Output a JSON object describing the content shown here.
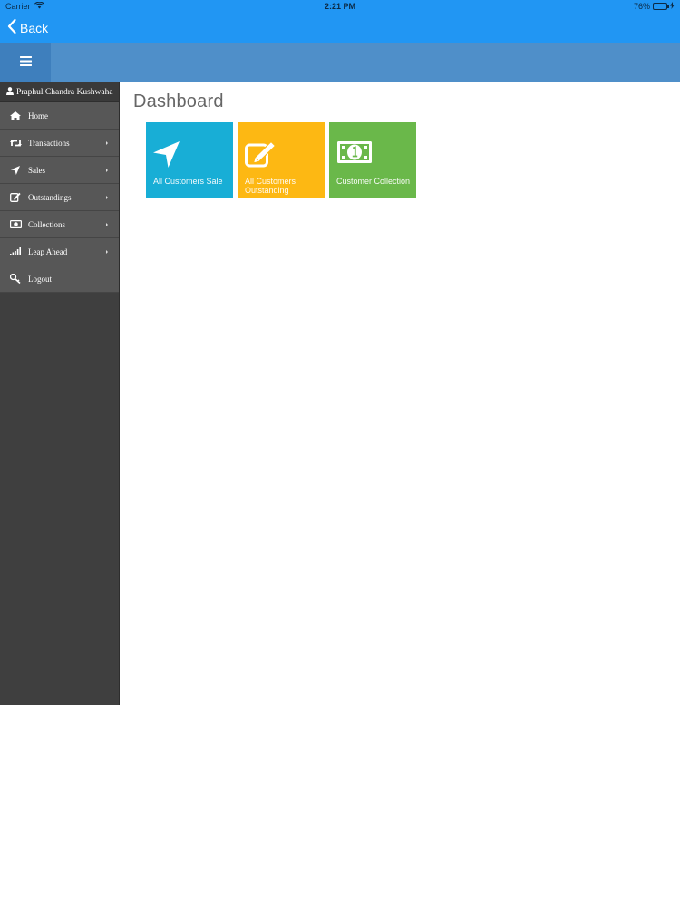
{
  "status_bar": {
    "carrier": "Carrier",
    "time": "2:21 PM",
    "battery": "76%",
    "battery_level": 0.76
  },
  "nav": {
    "back_label": "Back"
  },
  "sidebar": {
    "user_name": "Praphul Chandra Kushwaha",
    "items": [
      {
        "label": "Home",
        "icon": "home-icon",
        "has_submenu": false
      },
      {
        "label": "Transactions",
        "icon": "retweet-icon",
        "has_submenu": true
      },
      {
        "label": "Sales",
        "icon": "location-arrow-icon",
        "has_submenu": true
      },
      {
        "label": "Outstandings",
        "icon": "edit-icon",
        "has_submenu": true
      },
      {
        "label": "Collections",
        "icon": "money-icon",
        "has_submenu": true
      },
      {
        "label": "Leap Ahead",
        "icon": "signal-icon",
        "has_submenu": true
      },
      {
        "label": "Logout",
        "icon": "key-icon",
        "has_submenu": false
      }
    ]
  },
  "main": {
    "title": "Dashboard",
    "tiles": [
      {
        "label": "All Customers Sale",
        "icon": "location-arrow-icon",
        "color": "#18aed6"
      },
      {
        "label": "All Customers Outstanding",
        "icon": "edit-icon",
        "color": "#fdb813"
      },
      {
        "label": "Customer Collection",
        "icon": "money-icon",
        "color": "#6ab84a"
      }
    ]
  },
  "colors": {
    "nav_blue": "#2196f3",
    "header_blue": "#4f8fc9",
    "sidebar_bg": "#3f3f3f",
    "menu_item_bg": "#575757"
  }
}
